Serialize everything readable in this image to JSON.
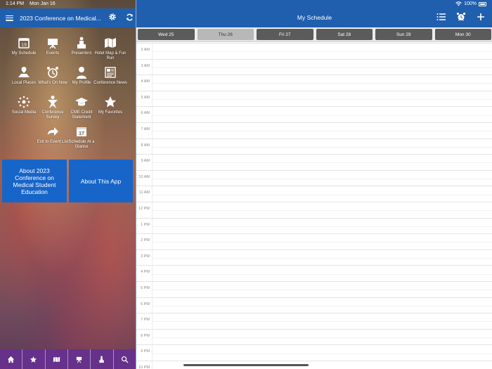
{
  "status": {
    "time": "1:14 PM",
    "date": "Mon Jan 16",
    "battery": "100%"
  },
  "left": {
    "title": "2023 Conference on Medical...",
    "tiles": [
      {
        "label": "My Schedule",
        "icon": "calendar-icon"
      },
      {
        "label": "Events",
        "icon": "easel-icon"
      },
      {
        "label": "Presenters",
        "icon": "presenter-icon"
      },
      {
        "label": "Hotel Map & Fun Run",
        "icon": "map-icon"
      },
      {
        "label": "Local Places",
        "icon": "places-icon"
      },
      {
        "label": "What's On Now",
        "icon": "alarm-clock-icon"
      },
      {
        "label": "My Profile",
        "icon": "person-icon"
      },
      {
        "label": "Conference News",
        "icon": "newspaper-icon"
      },
      {
        "label": "Social Media",
        "icon": "social-icon"
      },
      {
        "label": "Conference Survey",
        "icon": "survey-icon"
      },
      {
        "label": "CME Credit Statement",
        "icon": "graduation-cap-icon"
      },
      {
        "label": "My Favorites",
        "icon": "star-icon"
      },
      {
        "label": "Exit to Event List",
        "icon": "arrow-right-icon"
      },
      {
        "label": "Schedule At a Glance",
        "icon": "calendar-17-icon"
      }
    ],
    "about_conf": "About 2023 Conference on Medical Student Education",
    "about_app": "About This App",
    "bottom_icons": [
      "home-icon",
      "star-icon",
      "map-icon",
      "easel-icon",
      "presenter-icon",
      "search-icon"
    ]
  },
  "right": {
    "title": "My Schedule",
    "days": [
      {
        "label": "Wed 25",
        "selected": false
      },
      {
        "label": "Thu 26",
        "selected": true
      },
      {
        "label": "Fri 27",
        "selected": false
      },
      {
        "label": "Sat 28",
        "selected": false
      },
      {
        "label": "Sun 29",
        "selected": false
      },
      {
        "label": "Mon 30",
        "selected": false
      }
    ],
    "hours": [
      "2 AM",
      "3 AM",
      "4 AM",
      "5 AM",
      "6 AM",
      "7 AM",
      "8 AM",
      "9 AM",
      "10 AM",
      "11 AM",
      "12 PM",
      "1 PM",
      "2 PM",
      "3 PM",
      "4 PM",
      "5 PM",
      "6 PM",
      "7 PM",
      "8 PM",
      "9 PM",
      "10 PM"
    ]
  },
  "colors": {
    "header": "#1f5fae",
    "button": "#1765c8",
    "bottom_bar": "#66318a",
    "day_pill": "#5b5b5b",
    "day_selected": "#b8b8b8"
  }
}
